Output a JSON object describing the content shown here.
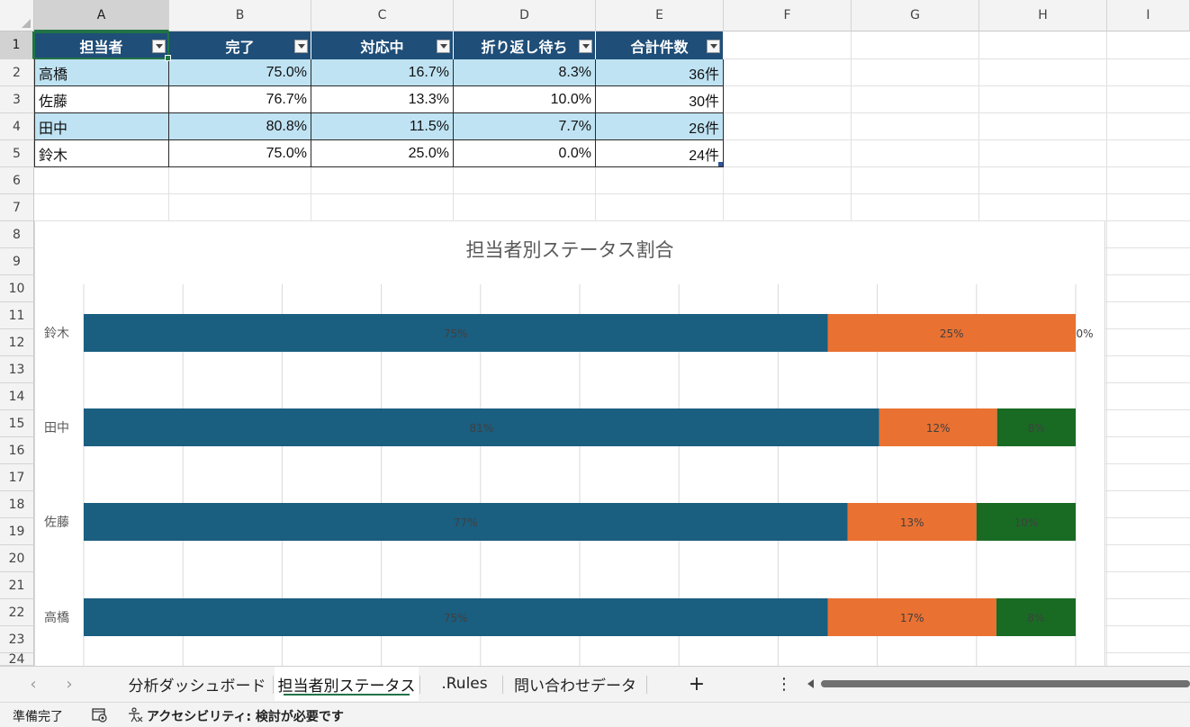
{
  "columns": [
    "A",
    "B",
    "C",
    "D",
    "E",
    "F",
    "G",
    "H",
    "I"
  ],
  "rows": [
    "1",
    "2",
    "3",
    "4",
    "5",
    "6",
    "7",
    "8",
    "9",
    "10",
    "11",
    "12",
    "13",
    "14",
    "15",
    "16",
    "17",
    "18",
    "19",
    "20",
    "21",
    "22",
    "23",
    "24"
  ],
  "table": {
    "headers": [
      "担当者",
      "完了",
      "対応中",
      "折り返し待ち",
      "合計件数"
    ],
    "rows": [
      [
        "高橋",
        "75.0%",
        "16.7%",
        "8.3%",
        "36件"
      ],
      [
        "佐藤",
        "76.7%",
        "13.3%",
        "10.0%",
        "30件"
      ],
      [
        "田中",
        "80.8%",
        "11.5%",
        "7.7%",
        "26件"
      ],
      [
        "鈴木",
        "75.0%",
        "25.0%",
        "0.0%",
        "24件"
      ]
    ]
  },
  "chart_data": {
    "type": "bar",
    "orientation": "horizontal",
    "stacked": "100%",
    "title": "担当者別ステータス割合",
    "categories": [
      "鈴木",
      "田中",
      "佐藤",
      "高橋"
    ],
    "series": [
      {
        "values": [
          75,
          81,
          77,
          75
        ],
        "labels": [
          "75%",
          "81%",
          "77%",
          "75%"
        ],
        "color": "#1a5e80"
      },
      {
        "values": [
          25,
          12,
          13,
          17
        ],
        "labels": [
          "25%",
          "12%",
          "13%",
          "17%"
        ],
        "color": "#e97132"
      },
      {
        "values": [
          0,
          8,
          10,
          8
        ],
        "labels": [
          "0%",
          "8%",
          "10%",
          "8%"
        ],
        "color": "#196b24"
      }
    ],
    "xlim": [
      0,
      100
    ],
    "grid": true,
    "legend": "none"
  },
  "sheet_tabs": [
    {
      "label": "分析ダッシュボード",
      "active": false
    },
    {
      "label": "担当者別ステータス",
      "active": true
    },
    {
      "label": ".Rules",
      "active": false
    },
    {
      "label": "問い合わせデータ",
      "active": false
    }
  ],
  "tab_controls": {
    "prev": "‹",
    "next": "›",
    "add": "+",
    "more": "⋮"
  },
  "status": {
    "ready": "準備完了",
    "accessibility": "アクセシビリティ: 検討が必要です"
  },
  "colors": {
    "header_fill": "#1f4e78",
    "band_fill": "#bfe3f3",
    "accent": "#217346"
  },
  "icons": [
    "macro-recording-icon",
    "accessibility-icon",
    "chevron-left-icon",
    "chevron-right-icon",
    "add-sheet-icon",
    "more-options-icon"
  ]
}
